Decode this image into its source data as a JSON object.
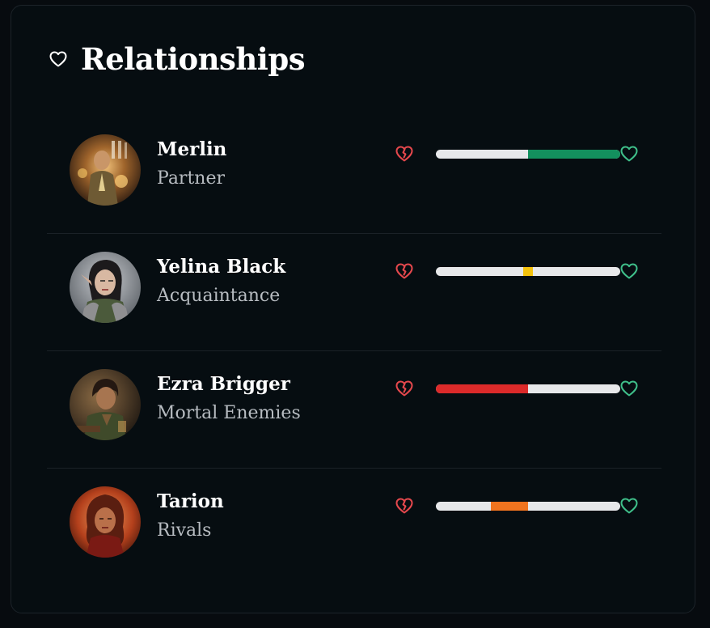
{
  "panel": {
    "title": "Relationships",
    "title_icon": "heart-outline-icon"
  },
  "colors": {
    "negative_icon": "#e5484d",
    "positive_icon": "#3fbf8a",
    "track": "#e7e8ea"
  },
  "relationships": [
    {
      "name": "Merlin",
      "status": "Partner",
      "avatar": "avatar-merlin",
      "score": 1.0,
      "bar_color": "#13905e"
    },
    {
      "name": "Yelina Black",
      "status": "Acquaintance",
      "avatar": "avatar-yelina-black",
      "score": 0.05,
      "bar_color": "#f4c20d"
    },
    {
      "name": "Ezra Brigger",
      "status": "Mortal Enemies",
      "avatar": "avatar-ezra-brigger",
      "score": -1.0,
      "bar_color": "#dc2a2a"
    },
    {
      "name": "Tarion",
      "status": "Rivals",
      "avatar": "avatar-tarion",
      "score": -0.4,
      "bar_color": "#f0741f"
    }
  ]
}
